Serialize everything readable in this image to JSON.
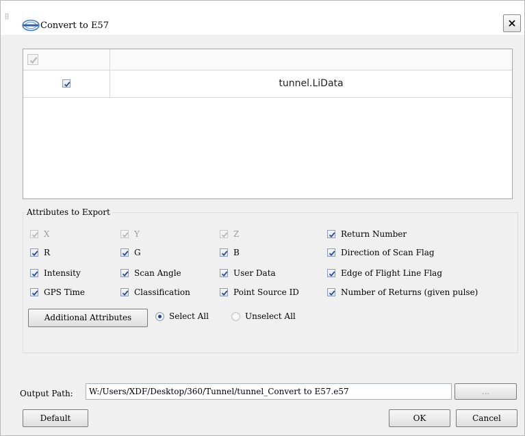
{
  "window": {
    "title": "Convert to E57",
    "icon": "lidar360-logo-icon",
    "close_icon": "close-icon"
  },
  "file_table": {
    "header_checked": true,
    "rows": [
      {
        "checked": true,
        "name": "tunnel.LiData"
      }
    ]
  },
  "attributes": {
    "group_title": "Attributes to Export",
    "items": [
      {
        "label": "X",
        "checked": true,
        "enabled": false
      },
      {
        "label": "Y",
        "checked": true,
        "enabled": false
      },
      {
        "label": "Z",
        "checked": true,
        "enabled": false
      },
      {
        "label": "Return Number",
        "checked": true,
        "enabled": true
      },
      {
        "label": "R",
        "checked": true,
        "enabled": true
      },
      {
        "label": "G",
        "checked": true,
        "enabled": true
      },
      {
        "label": "B",
        "checked": true,
        "enabled": true
      },
      {
        "label": "Direction of Scan Flag",
        "checked": true,
        "enabled": true
      },
      {
        "label": "Intensity",
        "checked": true,
        "enabled": true
      },
      {
        "label": "Scan Angle",
        "checked": true,
        "enabled": true
      },
      {
        "label": "User Data",
        "checked": true,
        "enabled": true
      },
      {
        "label": "Edge of Flight Line Flag",
        "checked": true,
        "enabled": true
      },
      {
        "label": "GPS Time",
        "checked": true,
        "enabled": true
      },
      {
        "label": "Classification",
        "checked": true,
        "enabled": true
      },
      {
        "label": "Point Source ID",
        "checked": true,
        "enabled": true
      },
      {
        "label": "Number of Returns (given pulse)",
        "checked": true,
        "enabled": true
      }
    ],
    "additional_button": "Additional Attributes",
    "select_all": "Select All",
    "unselect_all": "Unselect All",
    "selection_mode": "Select All"
  },
  "output": {
    "label": "Output Path:",
    "path": "W:/Users/XDF/Desktop/360/Tunnel/tunnel_Convert to E57.e57",
    "browse_label": "..."
  },
  "buttons": {
    "default": "Default",
    "ok": "OK",
    "cancel": "Cancel"
  },
  "colors": {
    "check_mark": "#2a4a8a",
    "disabled_check": "#b5b5b5",
    "radio_dot": "#1f3f86"
  }
}
